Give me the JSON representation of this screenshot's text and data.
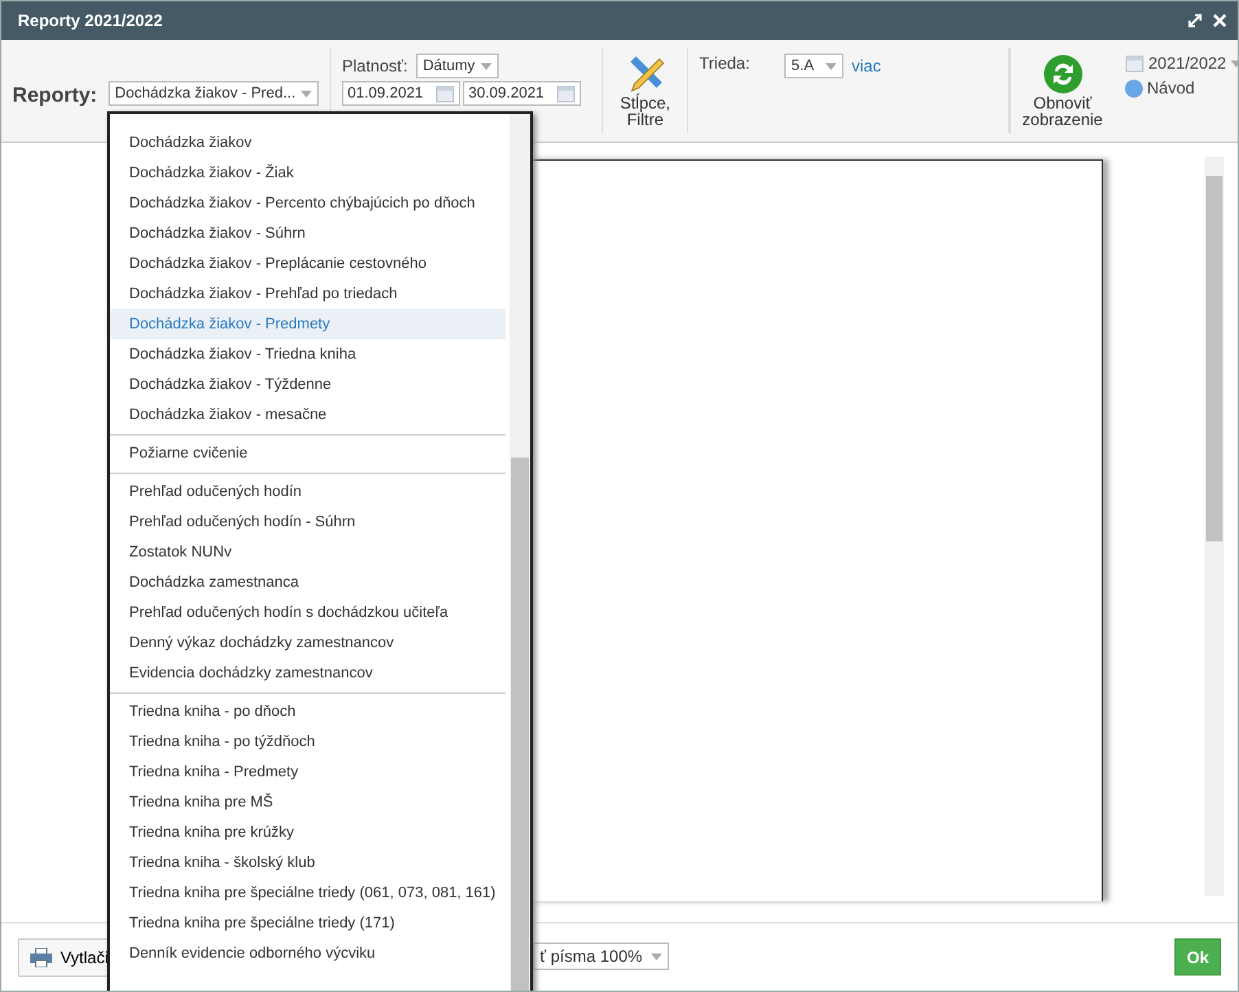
{
  "window": {
    "title": "Reporty 2021/2022"
  },
  "toolbar": {
    "reports_label": "Reporty:",
    "report_value": "Dochádzka žiakov - Pred...",
    "validity_label": "Platnosť:",
    "validity_value": "Dátumy",
    "date_from": "01.09.2021",
    "date_to": "30.09.2021",
    "columns_button": [
      "Stĺpce,",
      "Filtre"
    ],
    "class_label": "Trieda:",
    "class_value": "5.A",
    "more_link": "viac",
    "refresh_button": [
      "Obnoviť",
      "zobrazenie"
    ],
    "year": "2021/2022",
    "help": "Návod"
  },
  "dropdown": {
    "groups": [
      [
        {
          "label": "Dochádzka žiakov",
          "selected": false
        },
        {
          "label": "Dochádzka žiakov - Žiak",
          "selected": false
        },
        {
          "label": "Dochádzka žiakov - Percento chýbajúcich po dňoch",
          "selected": false
        },
        {
          "label": "Dochádzka žiakov - Súhrn",
          "selected": false
        },
        {
          "label": "Dochádzka žiakov - Preplácanie cestovného",
          "selected": false
        },
        {
          "label": "Dochádzka žiakov - Prehľad po triedach",
          "selected": false
        },
        {
          "label": "Dochádzka žiakov - Predmety",
          "selected": true
        },
        {
          "label": "Dochádzka žiakov - Triedna kniha",
          "selected": false
        },
        {
          "label": "Dochádzka žiakov - Týždenne",
          "selected": false
        },
        {
          "label": "Dochádzka žiakov - mesačne",
          "selected": false
        }
      ],
      [
        {
          "label": "Požiarne cvičenie",
          "selected": false
        }
      ],
      [
        {
          "label": "Prehľad odučených hodín",
          "selected": false
        },
        {
          "label": "Prehľad odučených hodín - Súhrn",
          "selected": false
        },
        {
          "label": "Zostatok NUNv",
          "selected": false
        },
        {
          "label": "Dochádzka zamestnanca",
          "selected": false
        },
        {
          "label": "Prehľad odučených hodín s dochádzkou učiteľa",
          "selected": false
        },
        {
          "label": "Denný výkaz dochádzky zamestnancov",
          "selected": false
        },
        {
          "label": "Evidencia dochádzky zamestnancov",
          "selected": false
        }
      ],
      [
        {
          "label": "Triedna kniha - po dňoch",
          "selected": false
        },
        {
          "label": "Triedna kniha - po týždňoch",
          "selected": false
        },
        {
          "label": "Triedna kniha - Predmety",
          "selected": false
        },
        {
          "label": "Triedna kniha pre MŠ",
          "selected": false
        },
        {
          "label": "Triedna kniha pre krúžky",
          "selected": false
        },
        {
          "label": "Triedna kniha - školský klub",
          "selected": false
        },
        {
          "label": "Triedna kniha pre špeciálne triedy (061, 073, 081, 161)",
          "selected": false
        },
        {
          "label": "Triedna kniha pre špeciálne triedy (171)",
          "selected": false
        },
        {
          "label": "Denník evidencie odborného výcviku",
          "selected": false
        }
      ]
    ]
  },
  "footer": {
    "print_button": "Vytlači",
    "font_size": "ť písma 100%",
    "ok_button": "Ok"
  }
}
